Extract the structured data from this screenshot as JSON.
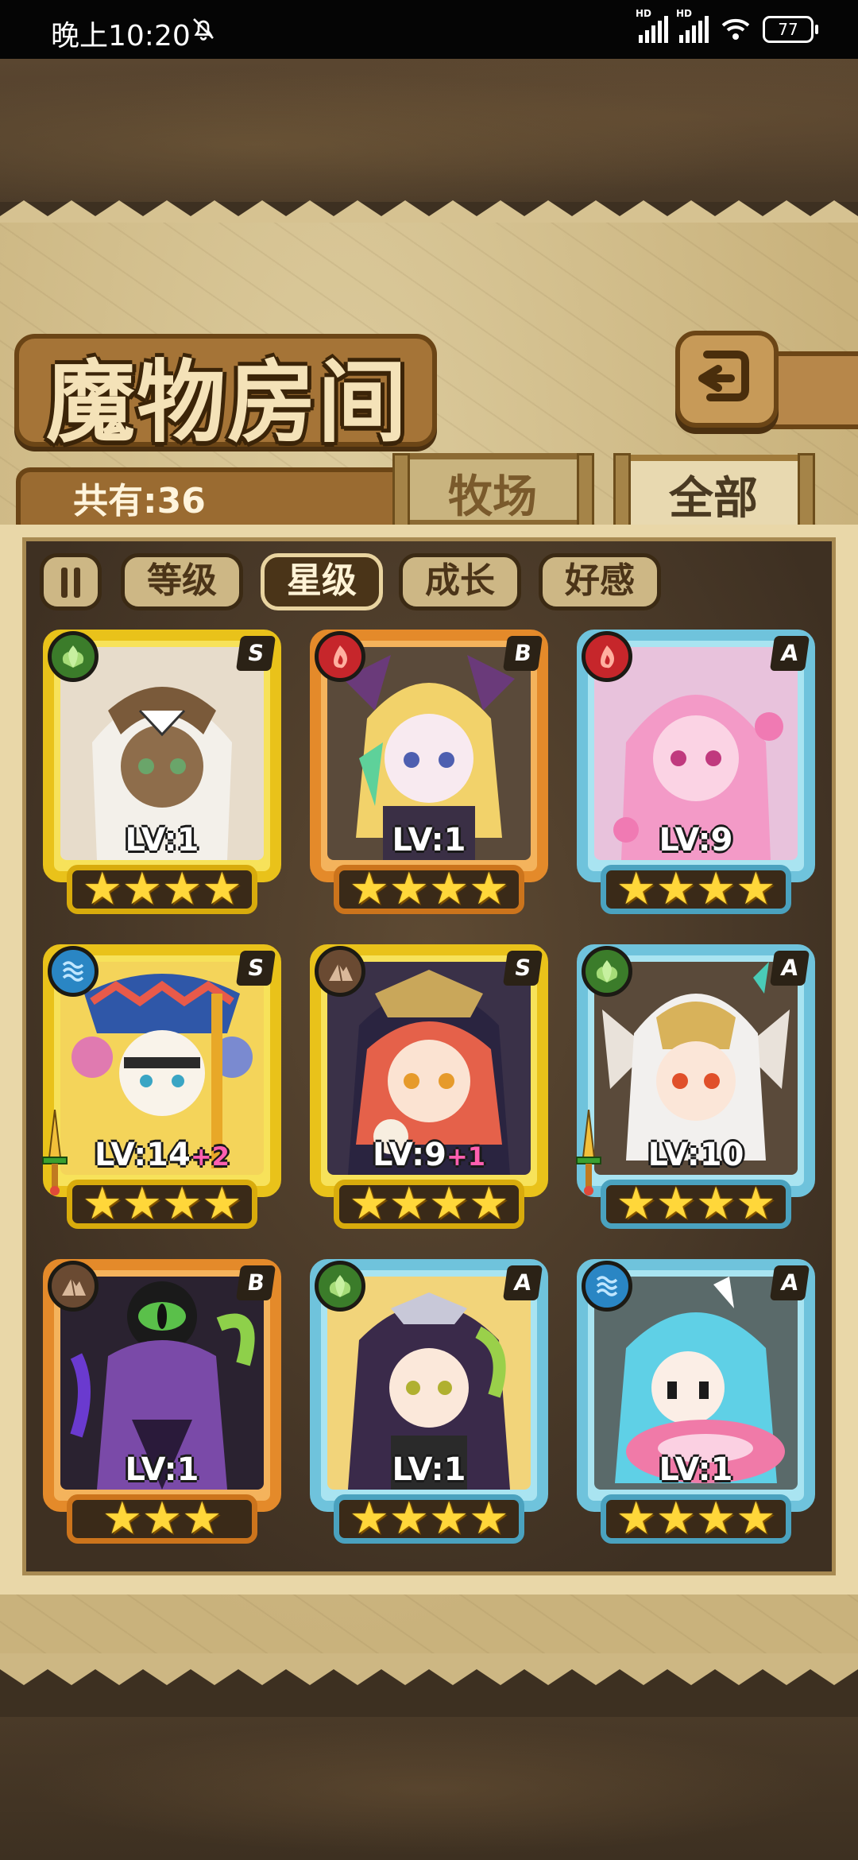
{
  "status_bar": {
    "time": "晚上10:20",
    "battery": "77",
    "icons": [
      "mute-bell-icon",
      "signal-icon",
      "signal-icon",
      "wifi-icon",
      "battery-icon"
    ]
  },
  "header": {
    "title": "魔物房间",
    "back_icon": "return-arrow-icon"
  },
  "collection": {
    "count_label": "共有:36"
  },
  "tabs": [
    {
      "label": "牧场",
      "active": false
    },
    {
      "label": "全部",
      "active": true
    }
  ],
  "filters": {
    "sort_icon": "sort-toggle-icon",
    "items": [
      {
        "label": "等级",
        "active": false
      },
      {
        "label": "星级",
        "active": true
      },
      {
        "label": "成长",
        "active": false
      },
      {
        "label": "好感",
        "active": false
      }
    ]
  },
  "colors": {
    "gold_frame": "#e9c21a",
    "orange_frame": "#e48a2a",
    "blue_frame": "#6fc3dc",
    "star": "#ffd73a",
    "plus": "#ff5fb0"
  },
  "monsters": [
    {
      "rank": "S",
      "element": "leaf-icon",
      "frame": "gold",
      "level": "LV:1",
      "plus": "",
      "stars": "★★★★",
      "weapon": false
    },
    {
      "rank": "B",
      "element": "fire-icon",
      "frame": "orange",
      "level": "LV:1",
      "plus": "",
      "stars": "★★★★",
      "weapon": false
    },
    {
      "rank": "A",
      "element": "fire-icon",
      "frame": "blue",
      "level": "LV:9",
      "plus": "",
      "stars": "★★★★",
      "weapon": false
    },
    {
      "rank": "S",
      "element": "water-icon",
      "frame": "gold",
      "level": "LV:14",
      "plus": "+2",
      "stars": "★★★★",
      "weapon": true
    },
    {
      "rank": "S",
      "element": "earth-icon",
      "frame": "gold",
      "level": "LV:9",
      "plus": "+1",
      "stars": "★★★★",
      "weapon": false
    },
    {
      "rank": "A",
      "element": "leaf-icon",
      "frame": "blue",
      "level": "LV:10",
      "plus": "",
      "stars": "★★★★",
      "weapon": true
    },
    {
      "rank": "B",
      "element": "earth-icon",
      "frame": "orange",
      "level": "LV:1",
      "plus": "",
      "stars": "★★★",
      "weapon": false
    },
    {
      "rank": "A",
      "element": "leaf-icon",
      "frame": "blue",
      "level": "LV:1",
      "plus": "",
      "stars": "★★★★",
      "weapon": false
    },
    {
      "rank": "A",
      "element": "water-icon",
      "frame": "blue",
      "level": "LV:1",
      "plus": "",
      "stars": "★★★★",
      "weapon": false
    }
  ]
}
